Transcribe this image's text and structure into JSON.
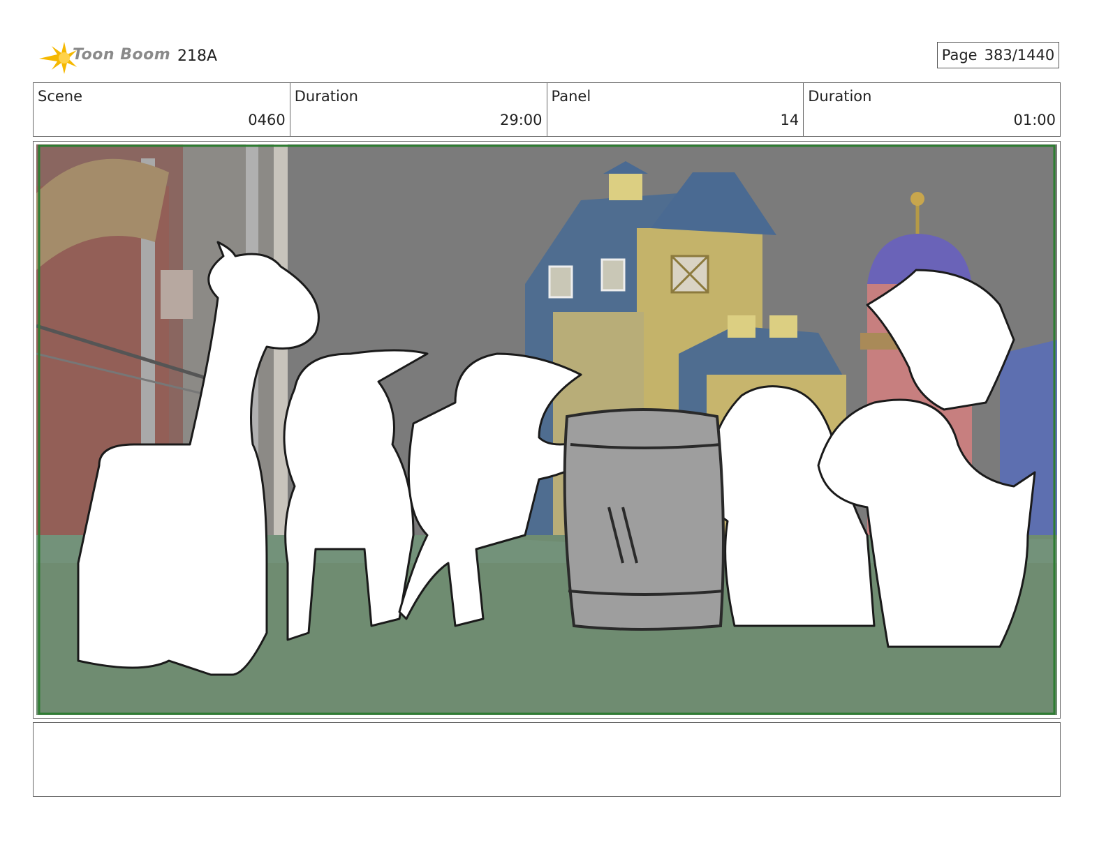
{
  "header": {
    "logo_text": "Toon Boom",
    "production_id": "218A",
    "page_label": "Page",
    "page_number": "383/1440"
  },
  "info": {
    "scene_label": "Scene",
    "scene_value": "0460",
    "duration_label": "Duration",
    "duration_value": "29:00",
    "panel_label": "Panel",
    "panel_value": "14",
    "panel_duration_label": "Duration",
    "panel_duration_value": "01:00"
  },
  "notes": {
    "text": ""
  },
  "colors": {
    "logo_accent": "#f5b800",
    "panel_border": "#2e7d32",
    "sky": "#7d7d7d",
    "grass": "#6f8f72",
    "roof": "#4a6b94",
    "barn_wall": "#c9b76a"
  }
}
